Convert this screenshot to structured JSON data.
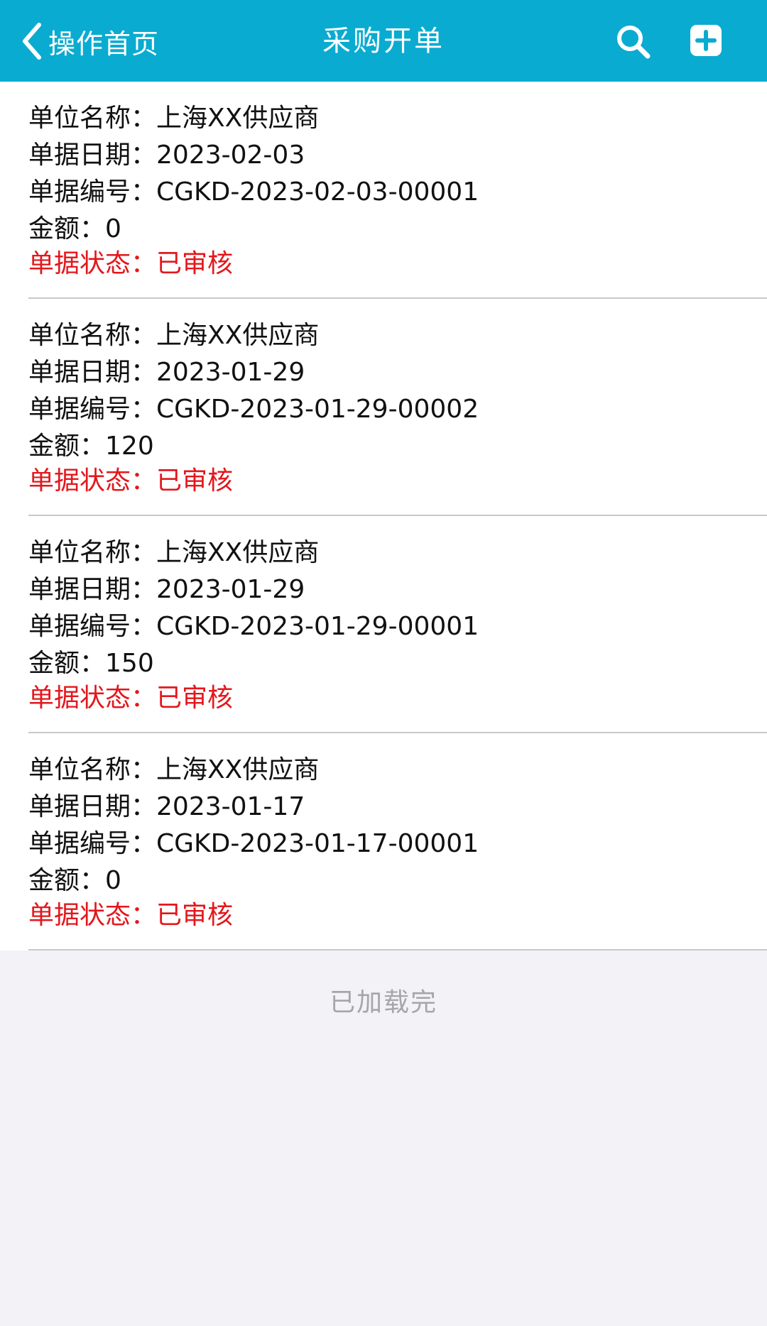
{
  "header": {
    "back_label": "操作首页",
    "title": "采购开单",
    "search_icon": "search-icon",
    "add_icon": "add-icon",
    "background_color": "#0aabd0"
  },
  "labels": {
    "supplier": "单位名称：",
    "date": "单据日期：",
    "number": "单据编号：",
    "amount": "金额：",
    "status": "单据状态："
  },
  "orders": [
    {
      "supplier": "上海XX供应商",
      "date": "2023-02-03",
      "number": "CGKD-2023-02-03-00001",
      "amount": "0",
      "status": "已审核"
    },
    {
      "supplier": "上海XX供应商",
      "date": "2023-01-29",
      "number": "CGKD-2023-01-29-00002",
      "amount": "120",
      "status": "已审核"
    },
    {
      "supplier": "上海XX供应商",
      "date": "2023-01-29",
      "number": "CGKD-2023-01-29-00001",
      "amount": "150",
      "status": "已审核"
    },
    {
      "supplier": "上海XX供应商",
      "date": "2023-01-17",
      "number": "CGKD-2023-01-17-00001",
      "amount": "0",
      "status": "已审核"
    }
  ],
  "footer": {
    "loaded_text": "已加载完"
  },
  "colors": {
    "status": "#e3171c",
    "muted": "#a6a6aa"
  }
}
